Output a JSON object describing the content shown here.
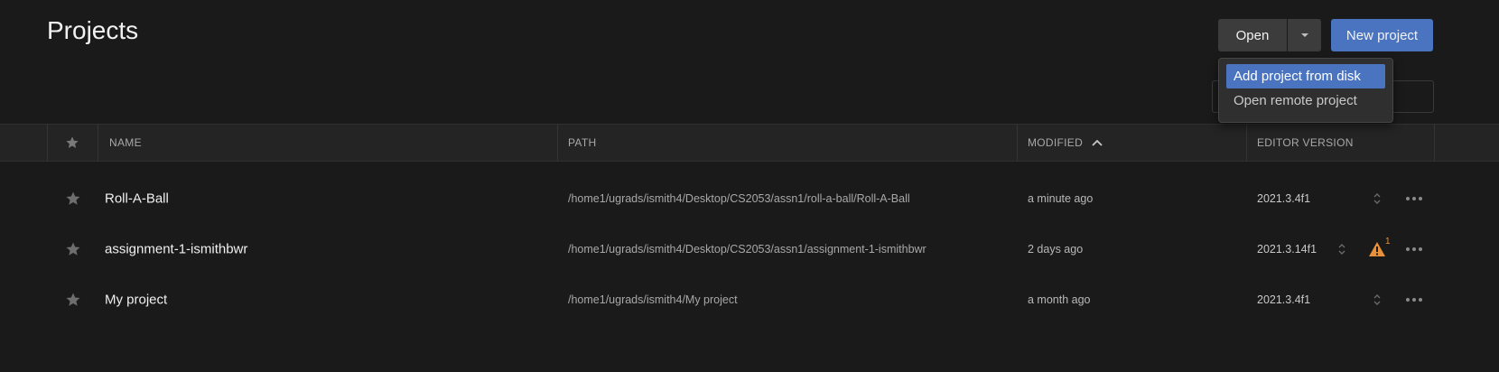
{
  "page": {
    "title": "Projects"
  },
  "toolbar": {
    "open_label": "Open",
    "new_project_label": "New project"
  },
  "open_menu": {
    "items": [
      {
        "label": "Add project from disk",
        "active": true
      },
      {
        "label": "Open remote project",
        "active": false
      }
    ]
  },
  "table": {
    "headers": {
      "name": "NAME",
      "path": "PATH",
      "modified": "MODIFIED",
      "editor": "EDITOR VERSION"
    },
    "sort": {
      "column": "modified",
      "direction": "ascending"
    },
    "rows": [
      {
        "name": "Roll-A-Ball",
        "path": "/home1/ugrads/ismith4/Desktop/CS2053/assn1/roll-a-ball/Roll-A-Ball",
        "modified": "a minute ago",
        "editor": "2021.3.4f1",
        "warning_count": null
      },
      {
        "name": "assignment-1-ismithbwr",
        "path": "/home1/ugrads/ismith4/Desktop/CS2053/assn1/assignment-1-ismithbwr",
        "modified": "2 days ago",
        "editor": "2021.3.14f1",
        "warning_count": "1"
      },
      {
        "name": "My project",
        "path": "/home1/ugrads/ismith4/My project",
        "modified": "a month ago",
        "editor": "2021.3.4f1",
        "warning_count": null
      }
    ]
  },
  "colors": {
    "background": "#1a1a1a",
    "accent": "#4a74c0",
    "warning": "#e8913a"
  },
  "icons": {
    "star": "star-icon",
    "sort": "chevron-up-icon",
    "dropdown": "caret-down-icon",
    "version_switch": "up-down-chevron-icon",
    "more": "more-horizontal-icon",
    "warning": "warning-triangle-icon"
  }
}
